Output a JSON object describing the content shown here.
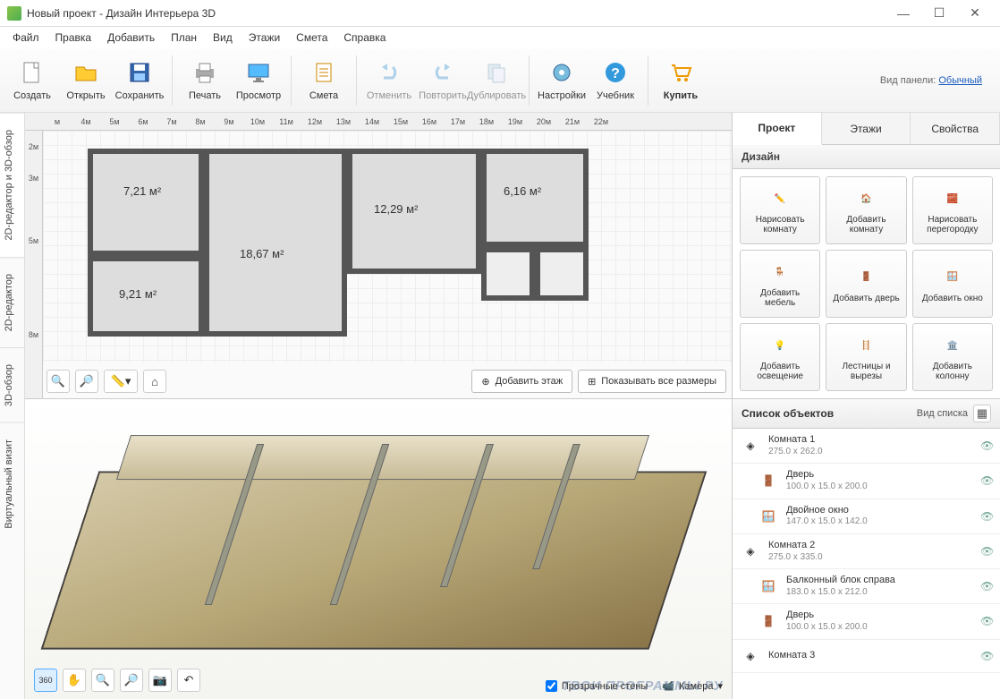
{
  "window": {
    "title": "Новый проект - Дизайн Интерьера 3D"
  },
  "menu": [
    "Файл",
    "Правка",
    "Добавить",
    "План",
    "Вид",
    "Этажи",
    "Смета",
    "Справка"
  ],
  "toolbar": {
    "create": "Создать",
    "open": "Открыть",
    "save": "Сохранить",
    "print": "Печать",
    "preview": "Просмотр",
    "budget": "Смета",
    "undo": "Отменить",
    "redo": "Повторить",
    "duplicate": "Дублировать",
    "settings": "Настройки",
    "tutorial": "Учебник",
    "buy": "Купить",
    "panel_label": "Вид панели:",
    "panel_mode": "Обычный"
  },
  "sidetabs": {
    "t1": "2D-редактор и 3D-обзор",
    "t2": "2D-редактор",
    "t3": "3D-обзор",
    "t4": "Виртуальный визит"
  },
  "ruler_h": [
    "м",
    "4м",
    "5м",
    "6м",
    "7м",
    "8м",
    "9м",
    "10м",
    "11м",
    "12м",
    "13м",
    "14м",
    "15м",
    "16м",
    "17м",
    "18м",
    "19м",
    "20м",
    "21м",
    "22м"
  ],
  "ruler_v": [
    "2м",
    "3м",
    "",
    "5м",
    "",
    "",
    "8м"
  ],
  "rooms": {
    "r1": "7,21 м²",
    "r2": "18,67 м²",
    "r3": "12,29 м²",
    "r4": "6,16 м²",
    "r5": "9,21 м²"
  },
  "plan_actions": {
    "add_floor": "Добавить этаж",
    "show_dims": "Показывать все размеры"
  },
  "view3d": {
    "transparent": "Прозрачные стены",
    "camera": "Камера"
  },
  "watermark": "ТВОИ ПРОГРАММЫ РУ",
  "rtabs": {
    "project": "Проект",
    "floors": "Этажи",
    "props": "Свойства"
  },
  "design_section": "Дизайн",
  "design": {
    "draw_room": "Нарисовать комнату",
    "add_room": "Добавить комнату",
    "draw_part": "Нарисовать перегородку",
    "add_furn": "Добавить мебель",
    "add_door": "Добавить дверь",
    "add_window": "Добавить окно",
    "add_light": "Добавить освещение",
    "stairs": "Лестницы и вырезы",
    "add_column": "Добавить колонну"
  },
  "objects": {
    "header": "Список объектов",
    "view_label": "Вид списка",
    "items": [
      {
        "name": "Комната 1",
        "dim": "275.0 x 262.0",
        "type": "room"
      },
      {
        "name": "Дверь",
        "dim": "100.0 x 15.0 x 200.0",
        "type": "door",
        "child": true
      },
      {
        "name": "Двойное окно",
        "dim": "147.0 x 15.0 x 142.0",
        "type": "window",
        "child": true
      },
      {
        "name": "Комната 2",
        "dim": "275.0 x 335.0",
        "type": "room"
      },
      {
        "name": "Балконный блок справа",
        "dim": "183.0 x 15.0 x 212.0",
        "type": "window",
        "child": true
      },
      {
        "name": "Дверь",
        "dim": "100.0 x 15.0 x 200.0",
        "type": "door",
        "child": true
      },
      {
        "name": "Комната 3",
        "dim": "",
        "type": "room"
      }
    ]
  }
}
